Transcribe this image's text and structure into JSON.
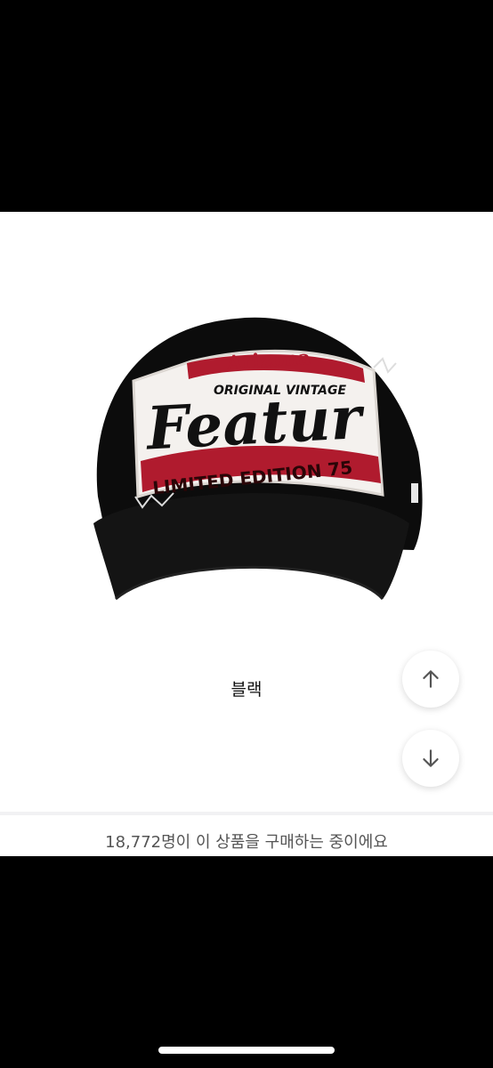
{
  "product": {
    "patch_top_text": "Arizona",
    "patch_sub_text": "ORIGINAL VINTAGE",
    "patch_main_text": "Featur",
    "patch_bottom_text": "LIMITED EDITION 75",
    "color_option": "블랙"
  },
  "footer": {
    "purchase_notice": "18,772명이 이 상품을 구매하는 중이에요"
  },
  "icons": {
    "scroll_up": "arrow-up-icon",
    "scroll_down": "arrow-down-icon"
  },
  "colors": {
    "cap": "#0b0b0b",
    "patch_red": "#b01b2e",
    "patch_white": "#f4f1ee"
  }
}
